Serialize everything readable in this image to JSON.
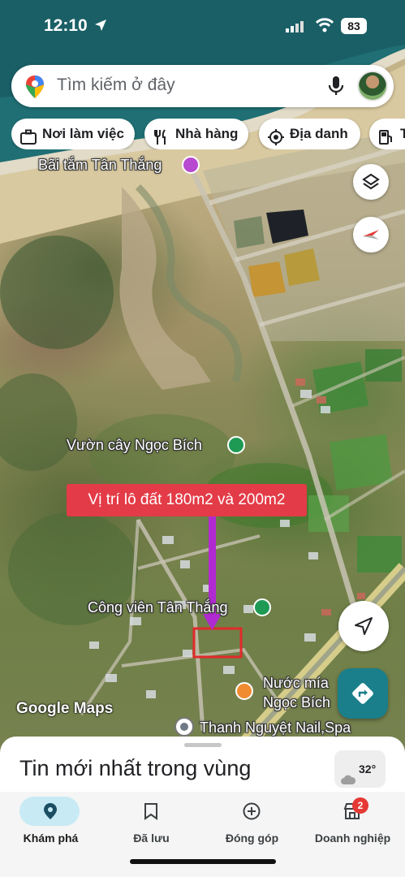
{
  "status_bar": {
    "time": "12:10",
    "battery": "83"
  },
  "search": {
    "placeholder": "Tìm kiếm ở đây"
  },
  "chips": [
    {
      "label": "Nơi làm việc",
      "icon": "briefcase-icon"
    },
    {
      "label": "Nhà hàng",
      "icon": "fork-knife-icon"
    },
    {
      "label": "Địa danh",
      "icon": "landmark-icon"
    },
    {
      "label": "T",
      "icon": "gas-station-icon"
    }
  ],
  "map": {
    "labels": {
      "beach": "Bãi tắm Tân Thắng",
      "garden": "Vườn cây Ngọc Bích",
      "park": "Công viên Tân Thắng",
      "juice_line1": "Nước mía",
      "juice_line2": "Ngọc Bích",
      "nail": "Thanh Nguyệt Nail,Spa"
    },
    "banner": "Vị trí lô đất 180m2 và 200m2",
    "attribution": "Google Maps",
    "colors": {
      "banner": "#e33b47",
      "arrow": "#b12ad1",
      "marker_box": "#e02a2a"
    }
  },
  "sheet": {
    "title": "Tin mới nhất trong vùng",
    "weather": "32°"
  },
  "bottom_nav": {
    "items": [
      {
        "label": "Khám phá",
        "icon": "explore-pin-icon",
        "active": true
      },
      {
        "label": "Đã lưu",
        "icon": "bookmark-icon",
        "active": false
      },
      {
        "label": "Đóng góp",
        "icon": "add-circle-icon",
        "active": false
      },
      {
        "label": "Doanh nghiệp",
        "icon": "store-icon",
        "active": false
      }
    ],
    "business_badge": "2"
  }
}
